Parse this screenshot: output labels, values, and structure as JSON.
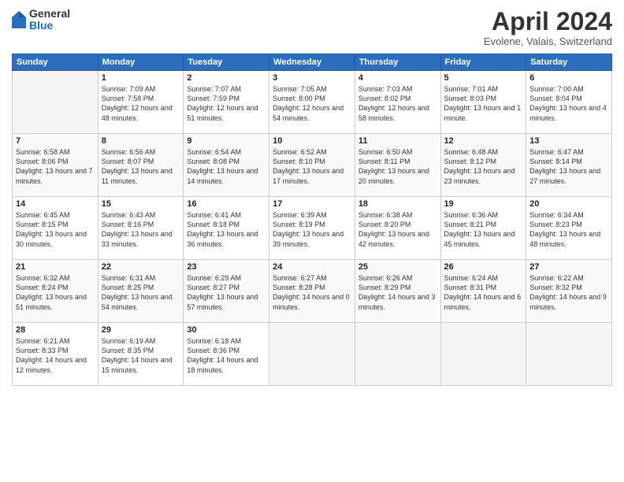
{
  "logo": {
    "general": "General",
    "blue": "Blue"
  },
  "header": {
    "month": "April 2024",
    "location": "Evolene, Valais, Switzerland"
  },
  "weekdays": [
    "Sunday",
    "Monday",
    "Tuesday",
    "Wednesday",
    "Thursday",
    "Friday",
    "Saturday"
  ],
  "weeks": [
    [
      {
        "day": "",
        "empty": true
      },
      {
        "day": "1",
        "sunrise": "Sunrise: 7:09 AM",
        "sunset": "Sunset: 7:58 PM",
        "daylight": "Daylight: 12 hours and 48 minutes."
      },
      {
        "day": "2",
        "sunrise": "Sunrise: 7:07 AM",
        "sunset": "Sunset: 7:59 PM",
        "daylight": "Daylight: 12 hours and 51 minutes."
      },
      {
        "day": "3",
        "sunrise": "Sunrise: 7:05 AM",
        "sunset": "Sunset: 8:00 PM",
        "daylight": "Daylight: 12 hours and 54 minutes."
      },
      {
        "day": "4",
        "sunrise": "Sunrise: 7:03 AM",
        "sunset": "Sunset: 8:02 PM",
        "daylight": "Daylight: 12 hours and 58 minutes."
      },
      {
        "day": "5",
        "sunrise": "Sunrise: 7:01 AM",
        "sunset": "Sunset: 8:03 PM",
        "daylight": "Daylight: 13 hours and 1 minute."
      },
      {
        "day": "6",
        "sunrise": "Sunrise: 7:00 AM",
        "sunset": "Sunset: 8:04 PM",
        "daylight": "Daylight: 13 hours and 4 minutes."
      }
    ],
    [
      {
        "day": "7",
        "sunrise": "Sunrise: 6:58 AM",
        "sunset": "Sunset: 8:06 PM",
        "daylight": "Daylight: 13 hours and 7 minutes."
      },
      {
        "day": "8",
        "sunrise": "Sunrise: 6:56 AM",
        "sunset": "Sunset: 8:07 PM",
        "daylight": "Daylight: 13 hours and 11 minutes."
      },
      {
        "day": "9",
        "sunrise": "Sunrise: 6:54 AM",
        "sunset": "Sunset: 8:08 PM",
        "daylight": "Daylight: 13 hours and 14 minutes."
      },
      {
        "day": "10",
        "sunrise": "Sunrise: 6:52 AM",
        "sunset": "Sunset: 8:10 PM",
        "daylight": "Daylight: 13 hours and 17 minutes."
      },
      {
        "day": "11",
        "sunrise": "Sunrise: 6:50 AM",
        "sunset": "Sunset: 8:11 PM",
        "daylight": "Daylight: 13 hours and 20 minutes."
      },
      {
        "day": "12",
        "sunrise": "Sunrise: 6:48 AM",
        "sunset": "Sunset: 8:12 PM",
        "daylight": "Daylight: 13 hours and 23 minutes."
      },
      {
        "day": "13",
        "sunrise": "Sunrise: 6:47 AM",
        "sunset": "Sunset: 8:14 PM",
        "daylight": "Daylight: 13 hours and 27 minutes."
      }
    ],
    [
      {
        "day": "14",
        "sunrise": "Sunrise: 6:45 AM",
        "sunset": "Sunset: 8:15 PM",
        "daylight": "Daylight: 13 hours and 30 minutes."
      },
      {
        "day": "15",
        "sunrise": "Sunrise: 6:43 AM",
        "sunset": "Sunset: 8:16 PM",
        "daylight": "Daylight: 13 hours and 33 minutes."
      },
      {
        "day": "16",
        "sunrise": "Sunrise: 6:41 AM",
        "sunset": "Sunset: 8:18 PM",
        "daylight": "Daylight: 13 hours and 36 minutes."
      },
      {
        "day": "17",
        "sunrise": "Sunrise: 6:39 AM",
        "sunset": "Sunset: 8:19 PM",
        "daylight": "Daylight: 13 hours and 39 minutes."
      },
      {
        "day": "18",
        "sunrise": "Sunrise: 6:38 AM",
        "sunset": "Sunset: 8:20 PM",
        "daylight": "Daylight: 13 hours and 42 minutes."
      },
      {
        "day": "19",
        "sunrise": "Sunrise: 6:36 AM",
        "sunset": "Sunset: 8:21 PM",
        "daylight": "Daylight: 13 hours and 45 minutes."
      },
      {
        "day": "20",
        "sunrise": "Sunrise: 6:34 AM",
        "sunset": "Sunset: 8:23 PM",
        "daylight": "Daylight: 13 hours and 48 minutes."
      }
    ],
    [
      {
        "day": "21",
        "sunrise": "Sunrise: 6:32 AM",
        "sunset": "Sunset: 8:24 PM",
        "daylight": "Daylight: 13 hours and 51 minutes."
      },
      {
        "day": "22",
        "sunrise": "Sunrise: 6:31 AM",
        "sunset": "Sunset: 8:25 PM",
        "daylight": "Daylight: 13 hours and 54 minutes."
      },
      {
        "day": "23",
        "sunrise": "Sunrise: 6:29 AM",
        "sunset": "Sunset: 8:27 PM",
        "daylight": "Daylight: 13 hours and 57 minutes."
      },
      {
        "day": "24",
        "sunrise": "Sunrise: 6:27 AM",
        "sunset": "Sunset: 8:28 PM",
        "daylight": "Daylight: 14 hours and 0 minutes."
      },
      {
        "day": "25",
        "sunrise": "Sunrise: 6:26 AM",
        "sunset": "Sunset: 8:29 PM",
        "daylight": "Daylight: 14 hours and 3 minutes."
      },
      {
        "day": "26",
        "sunrise": "Sunrise: 6:24 AM",
        "sunset": "Sunset: 8:31 PM",
        "daylight": "Daylight: 14 hours and 6 minutes."
      },
      {
        "day": "27",
        "sunrise": "Sunrise: 6:22 AM",
        "sunset": "Sunset: 8:32 PM",
        "daylight": "Daylight: 14 hours and 9 minutes."
      }
    ],
    [
      {
        "day": "28",
        "sunrise": "Sunrise: 6:21 AM",
        "sunset": "Sunset: 8:33 PM",
        "daylight": "Daylight: 14 hours and 12 minutes."
      },
      {
        "day": "29",
        "sunrise": "Sunrise: 6:19 AM",
        "sunset": "Sunset: 8:35 PM",
        "daylight": "Daylight: 14 hours and 15 minutes."
      },
      {
        "day": "30",
        "sunrise": "Sunrise: 6:18 AM",
        "sunset": "Sunset: 8:36 PM",
        "daylight": "Daylight: 14 hours and 18 minutes."
      },
      {
        "day": "",
        "empty": true
      },
      {
        "day": "",
        "empty": true
      },
      {
        "day": "",
        "empty": true
      },
      {
        "day": "",
        "empty": true
      }
    ]
  ]
}
